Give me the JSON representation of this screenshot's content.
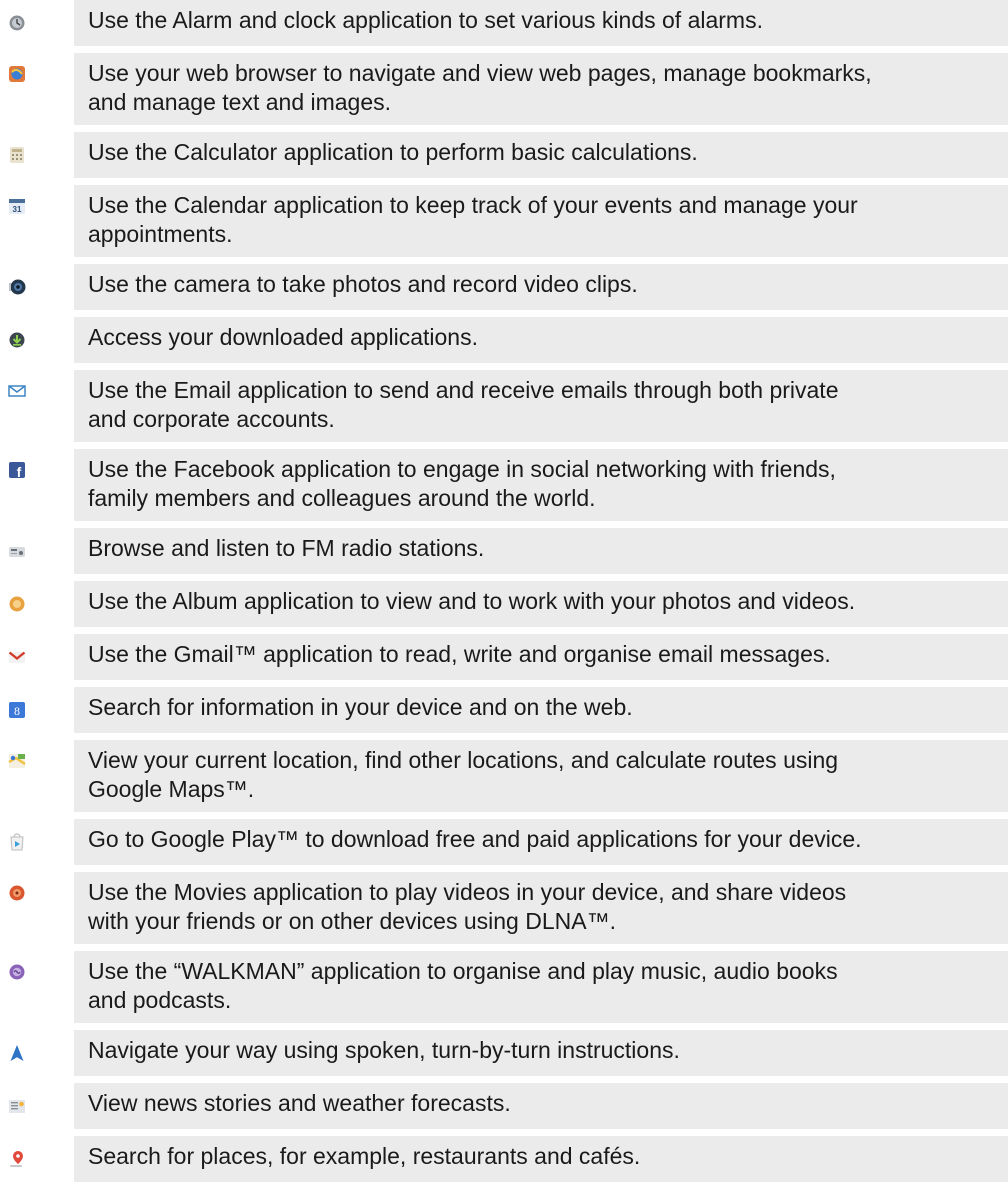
{
  "items": [
    {
      "name": "alarm",
      "icon": "alarm-clock-icon",
      "text": "Use the Alarm and clock application to set various kinds of alarms.",
      "lines": [
        "Use the Alarm and clock application to set various kinds of alarms."
      ]
    },
    {
      "name": "browser",
      "icon": "web-browser-icon",
      "text": "Use your web browser to navigate and view web pages, manage bookmarks, and manage text and images.",
      "lines": [
        "Use your web browser to navigate and view web pages, manage bookmarks,",
        "and manage text and images."
      ]
    },
    {
      "name": "calculator",
      "icon": "calculator-icon",
      "text": "Use the Calculator application to perform basic calculations.",
      "lines": [
        "Use the Calculator application to perform basic calculations."
      ]
    },
    {
      "name": "calendar",
      "icon": "calendar-icon",
      "icon_text": "31",
      "text": "Use the Calendar application to keep track of your events and manage your appointments.",
      "lines": [
        "Use the Calendar application to keep track of your events and manage your",
        "appointments."
      ]
    },
    {
      "name": "camera",
      "icon": "camera-icon",
      "text": "Use the camera to take photos and record video clips.",
      "lines": [
        "Use the camera to take photos and record video clips."
      ]
    },
    {
      "name": "downloads",
      "icon": "download-icon",
      "text": "Access your downloaded applications.",
      "lines": [
        "Access your downloaded applications."
      ]
    },
    {
      "name": "email",
      "icon": "email-envelope-icon",
      "text": "Use the Email application to send and receive emails through both private and corporate accounts.",
      "lines": [
        "Use the Email application to send and receive emails through both private",
        "and corporate accounts."
      ]
    },
    {
      "name": "facebook",
      "icon": "facebook-icon",
      "icon_text": "f",
      "text": "Use the Facebook application to engage in social networking with friends, family members and colleagues around the world.",
      "lines": [
        "Use the Facebook application to engage in social networking with friends,",
        "family members and colleagues around the world."
      ]
    },
    {
      "name": "fm-radio",
      "icon": "fm-radio-icon",
      "text": "Browse and listen to FM radio stations.",
      "lines": [
        "Browse and listen to FM radio stations."
      ]
    },
    {
      "name": "album",
      "icon": "album-icon",
      "text": "Use the Album application to view and to work with your photos and videos.",
      "lines": [
        "Use the Album application to view and to work with your photos and videos."
      ]
    },
    {
      "name": "gmail",
      "icon": "gmail-icon",
      "text": "Use the Gmail™ application to read, write and organise email messages.",
      "lines": [
        "Use the Gmail™ application to read, write and organise email messages."
      ]
    },
    {
      "name": "google-search",
      "icon": "google-search-icon",
      "icon_text": "8",
      "text": "Search for information in your device and on the web.",
      "lines": [
        "Search for information in your device and on the web."
      ]
    },
    {
      "name": "maps",
      "icon": "maps-icon",
      "text": "View your current location, find other locations, and calculate routes using Google Maps™.",
      "lines": [
        "View your current location, find other locations, and calculate routes using",
        "Google Maps™."
      ]
    },
    {
      "name": "play-store",
      "icon": "play-store-icon",
      "text": "Go to Google Play™ to download free and paid applications for your device.",
      "lines": [
        "Go to Google Play™ to download free and paid applications for your device."
      ]
    },
    {
      "name": "movies",
      "icon": "movies-icon",
      "text": "Use the Movies application to play videos in your device, and share videos with your friends or on other devices using DLNA™.",
      "lines": [
        "Use the Movies application to play videos in your device, and share videos",
        "with your friends or on other devices using DLNA™."
      ]
    },
    {
      "name": "walkman",
      "icon": "walkman-icon",
      "text": "Use the “WALKMAN” application to organise and play music, audio books and podcasts.",
      "lines": [
        "Use the “WALKMAN” application to organise and play music, audio books",
        "and podcasts."
      ]
    },
    {
      "name": "navigation",
      "icon": "navigation-arrow-icon",
      "text": "Navigate your way using spoken, turn-by-turn instructions.",
      "lines": [
        "Navigate your way using spoken, turn-by-turn instructions."
      ]
    },
    {
      "name": "news-weather",
      "icon": "news-weather-icon",
      "text": "View news stories and weather forecasts.",
      "lines": [
        "View news stories and weather forecasts."
      ]
    },
    {
      "name": "places",
      "icon": "places-pin-icon",
      "text": "Search for places, for example, restaurants and cafés.",
      "lines": [
        "Search for places, for example, restaurants and cafés."
      ]
    }
  ]
}
